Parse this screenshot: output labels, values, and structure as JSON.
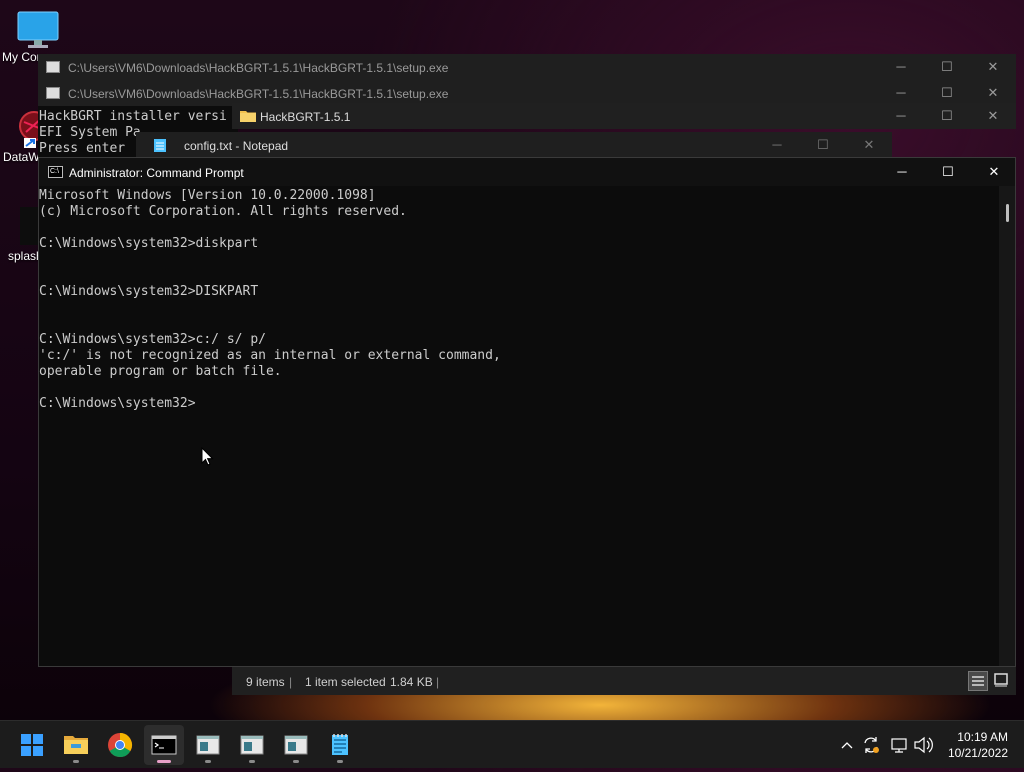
{
  "desktop": {
    "icons": [
      {
        "label": "My Com"
      },
      {
        "label": "DataW"
      },
      {
        "label": "splash"
      }
    ]
  },
  "setup_window_1": {
    "title": "C:\\Users\\VM6\\Downloads\\HackBGRT-1.5.1\\HackBGRT-1.5.1\\setup.exe"
  },
  "setup_window_2": {
    "title": "C:\\Users\\VM6\\Downloads\\HackBGRT-1.5.1\\HackBGRT-1.5.1\\setup.exe"
  },
  "setup_console": {
    "lines": [
      "HackBGRT installer versi",
      "EFI System Pa",
      "Press enter"
    ]
  },
  "explorer": {
    "title": "HackBGRT-1.5.1",
    "status_items": "9 items",
    "status_selected": "1 item selected",
    "status_size": "1.84 KB"
  },
  "notepad": {
    "title": "config.txt - Notepad"
  },
  "cmd": {
    "title": "Administrator: Command Prompt",
    "output": "Microsoft Windows [Version 10.0.22000.1098]\n(c) Microsoft Corporation. All rights reserved.\n\nC:\\Windows\\system32>diskpart\n\n\nC:\\Windows\\system32>DISKPART\n\n\nC:\\Windows\\system32>c:/ s/ p/\n'c:/' is not recognized as an internal or external command,\noperable program or batch file.\n\nC:\\Windows\\system32>"
  },
  "window_controls": {
    "minimize": "─",
    "maximize": "☐",
    "close": "✕"
  },
  "taskbar": {
    "apps": [
      {
        "icon": "windows-start-icon"
      },
      {
        "icon": "file-explorer-icon"
      },
      {
        "icon": "chrome-icon"
      },
      {
        "icon": "command-prompt-icon",
        "active": true
      },
      {
        "icon": "setup-window-icon"
      },
      {
        "icon": "setup-window-icon"
      },
      {
        "icon": "setup-window-icon"
      },
      {
        "icon": "notepad-icon"
      }
    ],
    "time": "10:19 AM",
    "date": "10/21/2022"
  },
  "colors": {
    "console_bg": "#0c0c0c",
    "console_text": "#cccccc",
    "taskbar_bg": "#1c1c1c"
  }
}
